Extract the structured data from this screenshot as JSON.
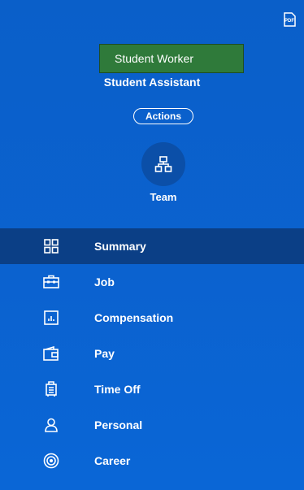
{
  "header": {
    "pdf_icon": "pdf-icon",
    "worker_name": "Student Worker",
    "job_title": "Student Assistant",
    "actions_label": "Actions"
  },
  "team": {
    "icon": "org-chart-icon",
    "label": "Team"
  },
  "nav": {
    "items": [
      {
        "label": "Summary",
        "icon": "grid-icon",
        "active": true
      },
      {
        "label": "Job",
        "icon": "briefcase-icon",
        "active": false
      },
      {
        "label": "Compensation",
        "icon": "chart-icon",
        "active": false
      },
      {
        "label": "Pay",
        "icon": "wallet-icon",
        "active": false
      },
      {
        "label": "Time Off",
        "icon": "luggage-icon",
        "active": false
      },
      {
        "label": "Personal",
        "icon": "person-icon",
        "active": false
      },
      {
        "label": "Career",
        "icon": "target-icon",
        "active": false
      }
    ]
  },
  "colors": {
    "panel_bg": "#0a62cf",
    "active_item_bg": "#0b3f86",
    "name_box_bg": "#2f7a3a"
  }
}
